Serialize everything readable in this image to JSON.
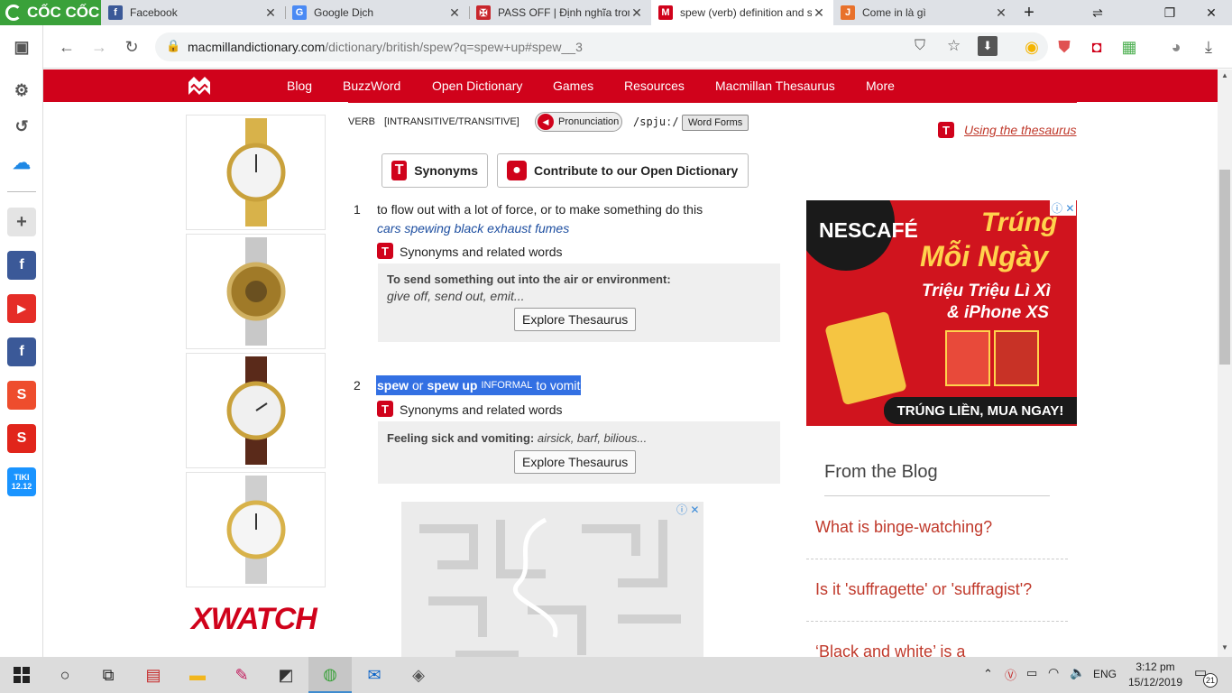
{
  "browser": {
    "brand": "CỐC CỐC",
    "tabs": [
      {
        "title": "Facebook"
      },
      {
        "title": "Google Dịch"
      },
      {
        "title": "PASS OFF | Định nghĩa trong"
      },
      {
        "title": "spew (verb) definition and s"
      },
      {
        "title": "Come in là gì"
      }
    ],
    "url_host": "macmillandictionary.com",
    "url_path": "/dictionary/british/spew?q=spew+up#spew__3"
  },
  "nav": {
    "links": [
      "Blog",
      "BuzzWord",
      "Open Dictionary",
      "Games",
      "Resources",
      "Macmillan Thesaurus",
      "More"
    ]
  },
  "entry": {
    "part_of_speech": "VERB",
    "grammar": "[INTRANSITIVE/TRANSITIVE]",
    "pronunciation_label": "Pronunciation",
    "pron": "/spjuː/",
    "word_forms_label": "Word Forms",
    "using_thesaurus": "Using the thesaurus",
    "synonyms_btn": "Synonyms",
    "contribute_btn": "Contribute to our Open Dictionary",
    "senses": [
      {
        "num": "1",
        "definition": "to flow out with a lot of force, or to make something do this",
        "example": "cars spewing black exhaust fumes",
        "syn_label": "Synonyms and related words",
        "thes_heading": "To send something out into the air or environment:",
        "thes_words": "give off, send out, emit...",
        "explore": "Explore Thesaurus"
      },
      {
        "num": "2",
        "w1": "spew",
        "or": "or",
        "w2": "spew up",
        "register": "INFORMAL",
        "definition": "to vomit",
        "syn_label": "Synonyms and related words",
        "thes_heading": "Feeling sick and vomiting:",
        "thes_words": "airsick, barf, bilious...",
        "explore": "Explore Thesaurus"
      }
    ]
  },
  "ads": {
    "watch_brand": "XWATCH",
    "nescafe_brand": "NESCAFÉ",
    "nescafe_line1": "Trúng",
    "nescafe_line2": "Mỗi Ngày",
    "nescafe_line3": "Triệu Triệu Lì Xì",
    "nescafe_line4": "& iPhone XS",
    "nescafe_cta": "TRÚNG LIỀN, MUA NGAY!"
  },
  "blog": {
    "heading": "From the Blog",
    "posts": [
      "What is binge-watching?",
      "Is it 'suffragette' or 'suffragist'?",
      "‘Black and white’ is a"
    ]
  },
  "taskbar": {
    "lang": "ENG",
    "time": "3:12 pm",
    "date": "15/12/2019",
    "notif_count": "21"
  },
  "colors": {
    "macmillan_red": "#d0021b",
    "coccoc_green": "#3aa13a",
    "link_red": "#c0392b",
    "selection": "#3370e3"
  }
}
